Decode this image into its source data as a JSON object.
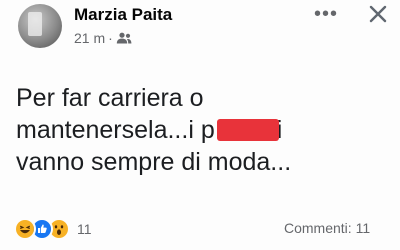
{
  "post": {
    "author": "Marzia Paita",
    "time": "21 m",
    "separator": "·",
    "audience_icon": "friends-icon",
    "more_label": "•••",
    "close_icon": "close-icon",
    "text_lines": [
      "Per far carriera o",
      "mantenersela...i p",
      "i",
      "vanno sempre di moda..."
    ]
  },
  "footer": {
    "reaction_icons": [
      "haha-emoji-icon",
      "like-icon",
      "wow-emoji-icon"
    ],
    "reaction_count": "11",
    "comments": "Commenti: 11"
  },
  "colors": {
    "redaction": "#e8333a",
    "like": "#1877f2",
    "emoji": "#f7b125",
    "secondary_text": "#65676b"
  }
}
